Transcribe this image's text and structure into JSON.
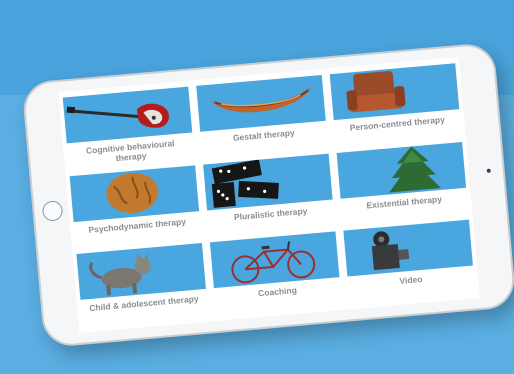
{
  "therapies": [
    {
      "label": "Cognitive behavioural therapy",
      "icon": "guitar-icon"
    },
    {
      "label": "Gestalt therapy",
      "icon": "canoe-icon"
    },
    {
      "label": "Person-centred therapy",
      "icon": "armchair-icon"
    },
    {
      "label": "Psychodynamic therapy",
      "icon": "walnut-icon"
    },
    {
      "label": "Pluralistic therapy",
      "icon": "dominoes-icon"
    },
    {
      "label": "Existential therapy",
      "icon": "tree-icon"
    },
    {
      "label": "Child & adolescent therapy",
      "icon": "cat-icon"
    },
    {
      "label": "Coaching",
      "icon": "bicycle-icon"
    },
    {
      "label": "Video",
      "icon": "video-camera-icon"
    }
  ],
  "colors": {
    "background": "#4aa3dc",
    "tile": "#4aa6de",
    "label": "#8a8d90"
  }
}
